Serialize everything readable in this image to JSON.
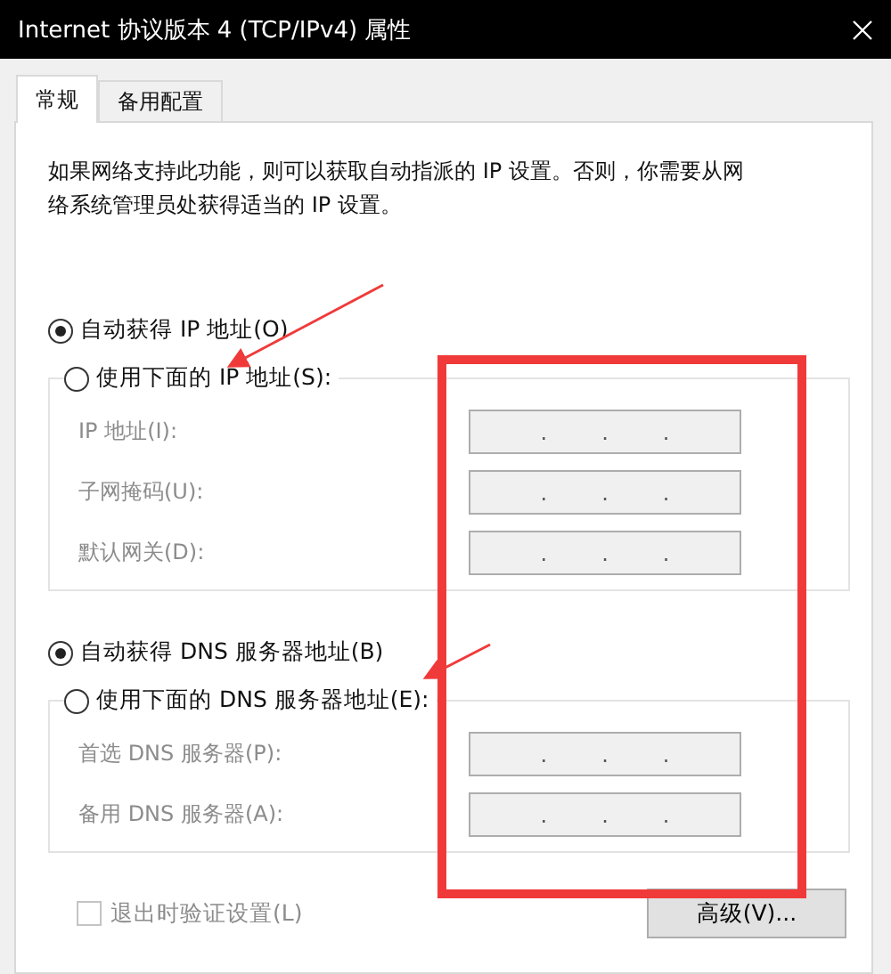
{
  "window": {
    "title": "Internet 协议版本 4 (TCP/IPv4) 属性"
  },
  "tabs": [
    {
      "label": "常规",
      "selected": true
    },
    {
      "label": "备用配置",
      "selected": false
    }
  ],
  "description": "如果网络支持此功能，则可以获取自动指派的 IP 设置。否则，你需要从网络系统管理员处获得适当的 IP 设置。",
  "sections": [
    {
      "options": [
        {
          "label": "自动获得 IP 地址(O)",
          "selected": true
        },
        {
          "label": "使用下面的 IP 地址(S):",
          "selected": false
        }
      ],
      "disabled": true,
      "fields": [
        {
          "label": "IP 地址(I):",
          "separators": [
            ".",
            ".",
            "."
          ]
        },
        {
          "label": "子网掩码(U):",
          "separators": [
            ".",
            ".",
            "."
          ]
        },
        {
          "label": "默认网关(D):",
          "separators": [
            ".",
            ".",
            "."
          ]
        }
      ]
    },
    {
      "options": [
        {
          "label": "自动获得 DNS 服务器地址(B)",
          "selected": true
        },
        {
          "label": "使用下面的 DNS 服务器地址(E):",
          "selected": false
        }
      ],
      "disabled": true,
      "fields": [
        {
          "label": "首选 DNS 服务器(P):",
          "separators": [
            ".",
            ".",
            "."
          ]
        },
        {
          "label": "备用 DNS 服务器(A):",
          "separators": [
            ".",
            ".",
            "."
          ]
        }
      ]
    }
  ],
  "validate_checkbox": {
    "label": "退出时验证设置(L)",
    "checked": false,
    "disabled": true
  },
  "advanced_button": {
    "label": "高级(V)..."
  },
  "annotations": [
    {
      "kind": "arrow"
    },
    {
      "kind": "arrow"
    },
    {
      "kind": "highlight-box"
    }
  ]
}
